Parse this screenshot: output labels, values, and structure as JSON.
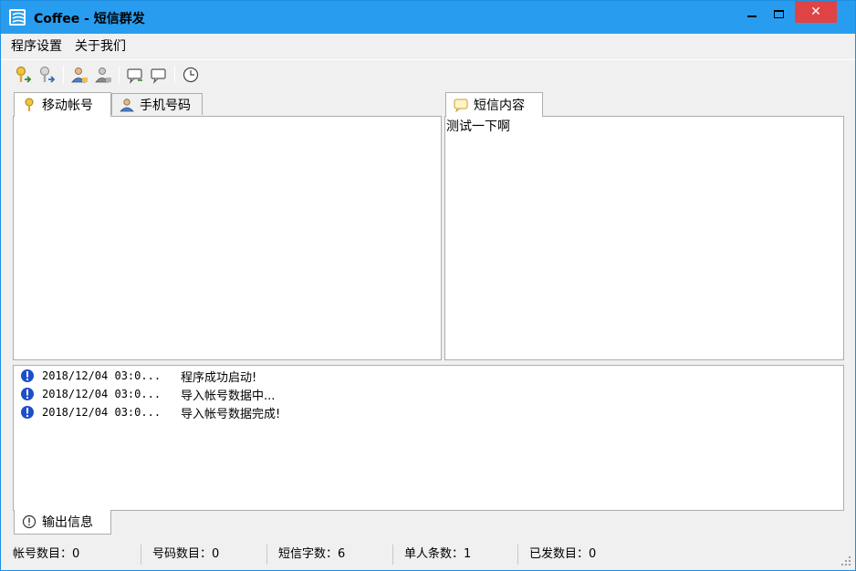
{
  "window": {
    "title": "Coffee - 短信群发"
  },
  "menu": [
    "程序设置",
    "关于我们"
  ],
  "toolbar": {
    "icons": [
      "key-import-icon",
      "key-export-icon",
      "user-import-icon",
      "user-export-icon",
      "message-import-icon",
      "message-export-icon",
      "clock-icon"
    ]
  },
  "left_tabs": [
    {
      "label": "移动帐号",
      "active": true
    },
    {
      "label": "手机号码",
      "active": false
    }
  ],
  "right_tab": {
    "label": "短信内容"
  },
  "sms_content": "测试一下啊",
  "log": [
    {
      "time": "2018/12/04 03:0...",
      "message": "程序成功启动!"
    },
    {
      "time": "2018/12/04 03:0...",
      "message": "导入帐号数据中..."
    },
    {
      "time": "2018/12/04 03:0...",
      "message": "导入帐号数据完成!"
    }
  ],
  "output_tab": {
    "label": "输出信息"
  },
  "status": {
    "accounts": "帐号数目：0",
    "numbers": "号码数目：0",
    "chars": "短信字数：6",
    "per_person": "单人条数：1",
    "sent": "已发数目：0"
  },
  "colors": {
    "titlebar": "#289df0",
    "close": "#e04343",
    "info": "#1d4fc9"
  }
}
